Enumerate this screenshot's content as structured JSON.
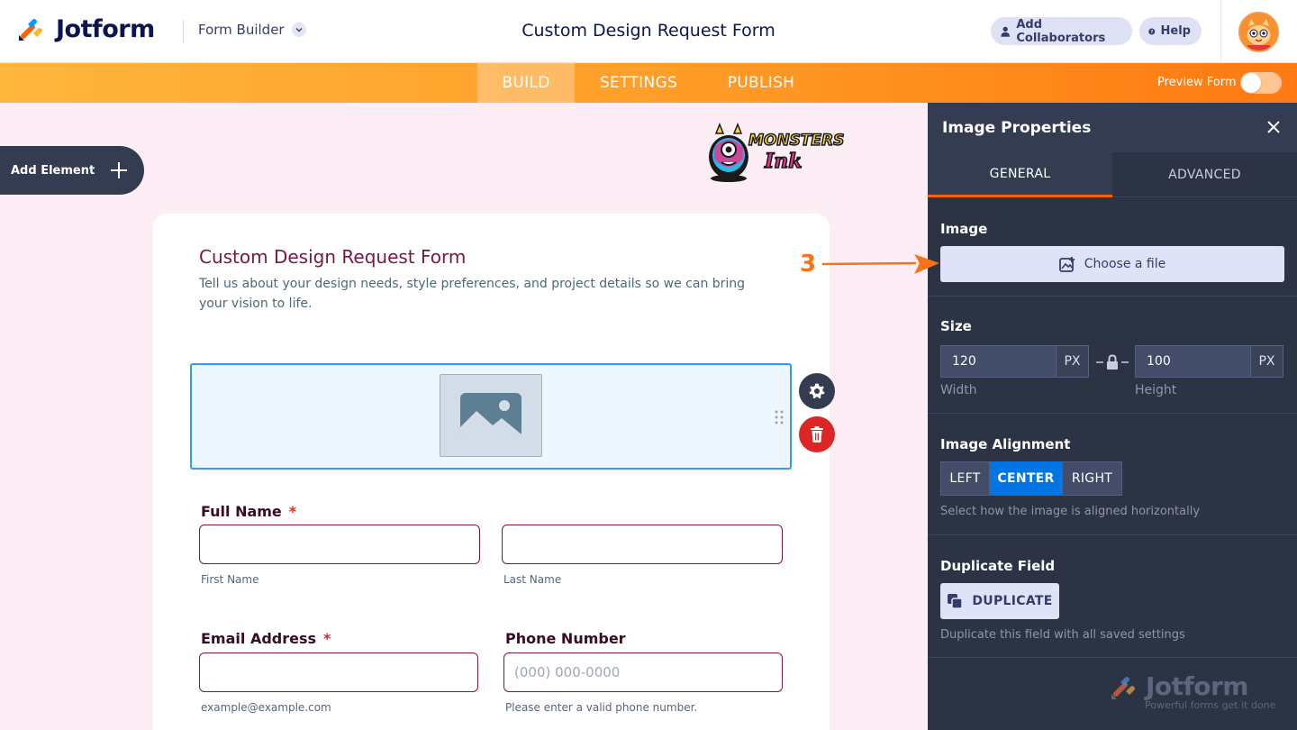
{
  "header": {
    "brand": "Jotform",
    "mode": "Form Builder",
    "title": "Custom Design Request Form",
    "collab_label": "Add Collaborators",
    "help_label": "Help"
  },
  "nav": {
    "tabs": [
      "BUILD",
      "SETTINGS",
      "PUBLISH"
    ],
    "active_tab": "BUILD",
    "preview_label": "Preview Form",
    "preview_on": false
  },
  "sidebar": {
    "add_element_label": "Add Element"
  },
  "brand_logo": {
    "line1": "MONSTERS",
    "line2": "Ink"
  },
  "form": {
    "title": "Custom Design Request Form",
    "description": "Tell us about your design needs, style preferences, and project details so we can bring your vision to life.",
    "fields": {
      "full_name": {
        "label": "Full Name",
        "required_mark": "*",
        "first_sub": "First Name",
        "last_sub": "Last Name"
      },
      "email": {
        "label": "Email Address",
        "required_mark": "*",
        "sub": "example@example.com"
      },
      "phone": {
        "label": "Phone Number",
        "placeholder": "(000) 000-0000",
        "sub": "Please enter a valid phone number."
      }
    }
  },
  "annotation": {
    "number": "3"
  },
  "panel": {
    "title": "Image Properties",
    "tabs": [
      "GENERAL",
      "ADVANCED"
    ],
    "active_tab": "GENERAL",
    "image": {
      "label": "Image",
      "button": "Choose a file"
    },
    "size": {
      "label": "Size",
      "width": "120",
      "height": "100",
      "unit": "PX",
      "width_label": "Width",
      "height_label": "Height"
    },
    "alignment": {
      "label": "Image Alignment",
      "options": [
        "LEFT",
        "CENTER",
        "RIGHT"
      ],
      "selected": "CENTER",
      "hint": "Select how the image is aligned horizontally"
    },
    "duplicate": {
      "label": "Duplicate Field",
      "button": "DUPLICATE",
      "hint": "Duplicate this field with all saved settings"
    },
    "footer": {
      "brand": "Jotform",
      "tagline": "Powerful forms get it done"
    }
  },
  "colors": {
    "accent_orange": "#ff6100",
    "active_blue": "#0075e3",
    "panel_bg": "#2c3345",
    "form_title": "#7a1544",
    "required": "#dc2626"
  }
}
